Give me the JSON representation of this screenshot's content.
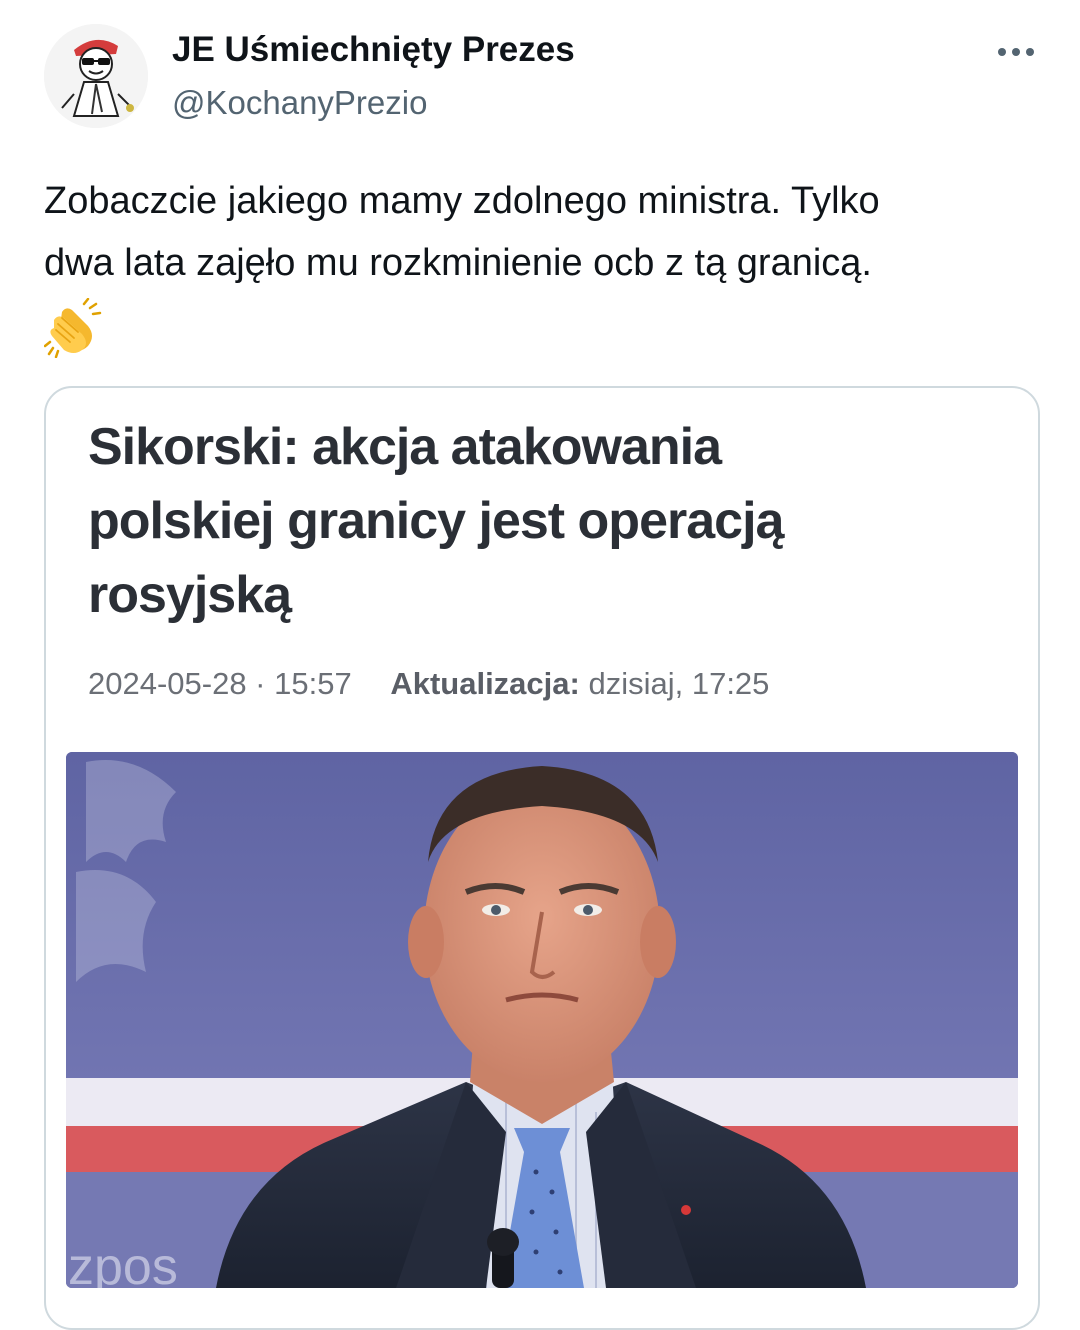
{
  "author": {
    "display_name": "JE Uśmiechnięty Prezes",
    "handle": "@KochanyPrezio"
  },
  "tweet": {
    "text_lines": [
      "Zobaczcie jakiego mamy zdolnego ministra. Tylko",
      "dwa lata zajęło mu rozkminienie ocb z tą granicą."
    ],
    "emoji": "clapping-hands"
  },
  "card": {
    "headline_lines": [
      "Sikorski: akcja atakowania",
      "polskiej granicy jest operacją",
      "rosyjską"
    ],
    "date": "2024-05-28 · 15:57",
    "updated_label": "Aktualizacja:",
    "updated_value": "dzisiaj, 17:25",
    "photo_backdrop_text": "zpos"
  },
  "colors": {
    "text_primary": "#0f1419",
    "text_secondary": "#536471",
    "card_border": "#cfd9de",
    "photo_backdrop": "#6f74ad",
    "stripe_red": "#d95a5e"
  }
}
